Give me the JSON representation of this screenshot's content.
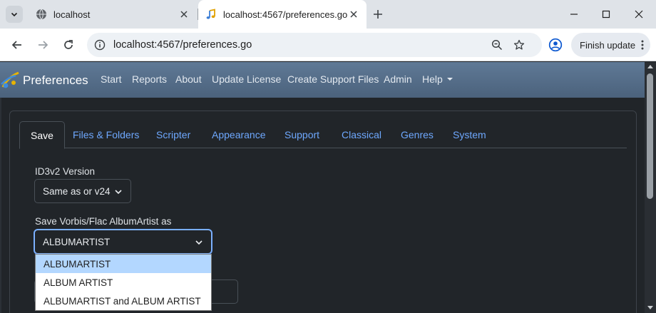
{
  "browser": {
    "tabs": [
      {
        "title": "localhost",
        "active": false
      },
      {
        "title": "localhost:4567/preferences.go",
        "active": true
      }
    ],
    "address": "localhost:4567/preferences.go",
    "update_button": "Finish update"
  },
  "navbar": {
    "brand": "Preferences",
    "links": [
      "Start",
      "Reports",
      "About",
      "Update License",
      "Create Support Files",
      "Admin",
      "Help"
    ]
  },
  "pref_tabs": [
    {
      "label": "Save",
      "active": true
    },
    {
      "label": "Files & Folders",
      "active": false
    },
    {
      "label": "Scripter",
      "active": false
    },
    {
      "label": "Appearance",
      "active": false
    },
    {
      "label": "Support",
      "active": false
    },
    {
      "label": "Classical",
      "active": false
    },
    {
      "label": "Genres",
      "active": false
    },
    {
      "label": "System",
      "active": false
    }
  ],
  "form": {
    "id3v2": {
      "label": "ID3v2 Version",
      "value": "Same as or v24"
    },
    "albumartist": {
      "label": "Save Vorbis/Flac AlbumArtist as",
      "value": "ALBUMARTIST",
      "options": [
        "ALBUMARTIST",
        "ALBUM ARTIST",
        "ALBUMARTIST and ALBUM ARTIST"
      ],
      "highlighted_index": 0
    }
  },
  "colors": {
    "accent": "#6ea8fe",
    "navbar": "#56708c",
    "page_bg": "#212529"
  }
}
